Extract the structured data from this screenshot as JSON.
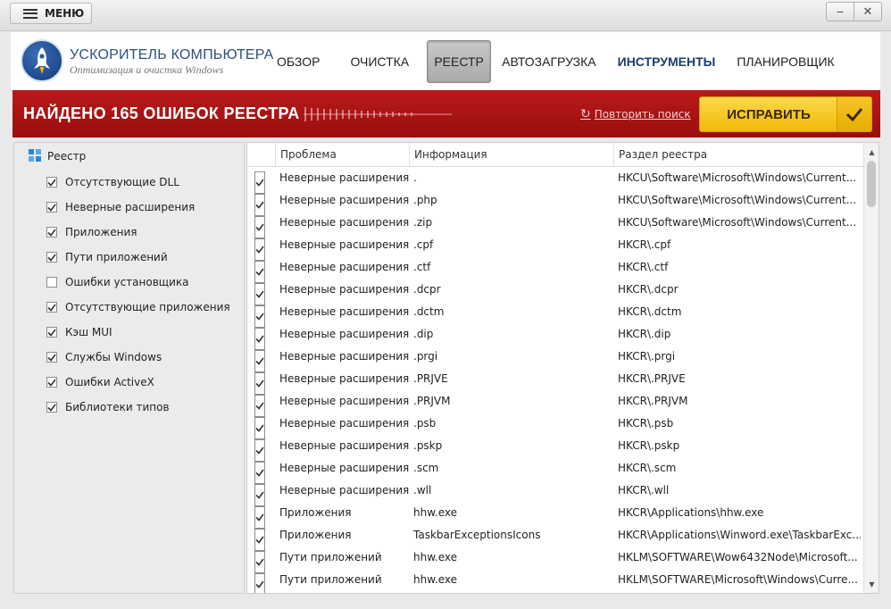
{
  "titlebar": {
    "menu_label": "МЕНЮ",
    "minimize_glyph": "‒",
    "close_glyph": "✕"
  },
  "header": {
    "app_title": "УСКОРИТЕЛЬ КОМПЬЮТЕРА",
    "app_subtitle": "Оптимизация и очистка Windows",
    "nav": [
      {
        "label": "ОБЗОР"
      },
      {
        "label": "ОЧИСТКА"
      },
      {
        "label": "РЕЕСТР",
        "active": true
      },
      {
        "label": "АВТОЗАГРУЗКА"
      },
      {
        "label": "ИНСТРУМЕНТЫ",
        "emphasis": true
      },
      {
        "label": "ПЛАНИРОВЩИК"
      }
    ]
  },
  "banner": {
    "title": "НАЙДЕНО 165 ОШИБОК РЕЕСТРА",
    "retry_label": "Повторить поиск",
    "fix_label": "ИСПРАВИТЬ"
  },
  "sidebar": {
    "root_label": "Реестр",
    "items": [
      {
        "label": "Отсутствующие DLL",
        "checked": true
      },
      {
        "label": "Неверные расширения",
        "checked": true
      },
      {
        "label": "Приложения",
        "checked": true
      },
      {
        "label": "Пути приложений",
        "checked": true
      },
      {
        "label": "Ошибки установщика",
        "checked": false
      },
      {
        "label": "Отсутствующие приложения",
        "checked": true
      },
      {
        "label": "Кэш MUI",
        "checked": true
      },
      {
        "label": "Службы Windows",
        "checked": true
      },
      {
        "label": "Ошибки ActiveX",
        "checked": true
      },
      {
        "label": "Библиотеки типов",
        "checked": true
      }
    ]
  },
  "table": {
    "columns": [
      "Проблема",
      "Информация",
      "Раздел реестра"
    ],
    "rows": [
      {
        "problem": "Неверные расширения",
        "info": ".",
        "key": "HKCU\\Software\\Microsoft\\Windows\\Current...",
        "checked": true
      },
      {
        "problem": "Неверные расширения",
        "info": ".php",
        "key": "HKCU\\Software\\Microsoft\\Windows\\Current...",
        "checked": true
      },
      {
        "problem": "Неверные расширения",
        "info": ".zip",
        "key": "HKCU\\Software\\Microsoft\\Windows\\Current...",
        "checked": true
      },
      {
        "problem": "Неверные расширения",
        "info": ".cpf",
        "key": "HKCR\\.cpf",
        "checked": true
      },
      {
        "problem": "Неверные расширения",
        "info": ".ctf",
        "key": "HKCR\\.ctf",
        "checked": true
      },
      {
        "problem": "Неверные расширения",
        "info": ".dcpr",
        "key": "HKCR\\.dcpr",
        "checked": true
      },
      {
        "problem": "Неверные расширения",
        "info": ".dctm",
        "key": "HKCR\\.dctm",
        "checked": true
      },
      {
        "problem": "Неверные расширения",
        "info": ".dip",
        "key": "HKCR\\.dip",
        "checked": true
      },
      {
        "problem": "Неверные расширения",
        "info": ".prgi",
        "key": "HKCR\\.prgi",
        "checked": true
      },
      {
        "problem": "Неверные расширения",
        "info": ".PRJVE",
        "key": "HKCR\\.PRJVE",
        "checked": true
      },
      {
        "problem": "Неверные расширения",
        "info": ".PRJVM",
        "key": "HKCR\\.PRJVM",
        "checked": true
      },
      {
        "problem": "Неверные расширения",
        "info": ".psb",
        "key": "HKCR\\.psb",
        "checked": true
      },
      {
        "problem": "Неверные расширения",
        "info": ".pskp",
        "key": "HKCR\\.pskp",
        "checked": true
      },
      {
        "problem": "Неверные расширения",
        "info": ".scm",
        "key": "HKCR\\.scm",
        "checked": true
      },
      {
        "problem": "Неверные расширения",
        "info": ".wll",
        "key": "HKCR\\.wll",
        "checked": true
      },
      {
        "problem": "Приложения",
        "info": "hhw.exe",
        "key": "HKCR\\Applications\\hhw.exe",
        "checked": true
      },
      {
        "problem": "Приложения",
        "info": "TaskbarExceptionsIcons",
        "key": "HKCR\\Applications\\Winword.exe\\TaskbarExc...",
        "checked": true
      },
      {
        "problem": "Пути приложений",
        "info": "hhw.exe",
        "key": "HKLM\\SOFTWARE\\Wow6432Node\\Microsoft...",
        "checked": true
      },
      {
        "problem": "Пути приложений",
        "info": "hhw.exe",
        "key": "HKLM\\SOFTWARE\\Microsoft\\Windows\\Curre...",
        "checked": true
      }
    ]
  },
  "colors": {
    "banner_red": "#b81a1a",
    "fix_yellow": "#f8cc1c",
    "nav_active_gray": "#b4b4b4",
    "nav_emphasis_blue": "#1b3d6b"
  }
}
